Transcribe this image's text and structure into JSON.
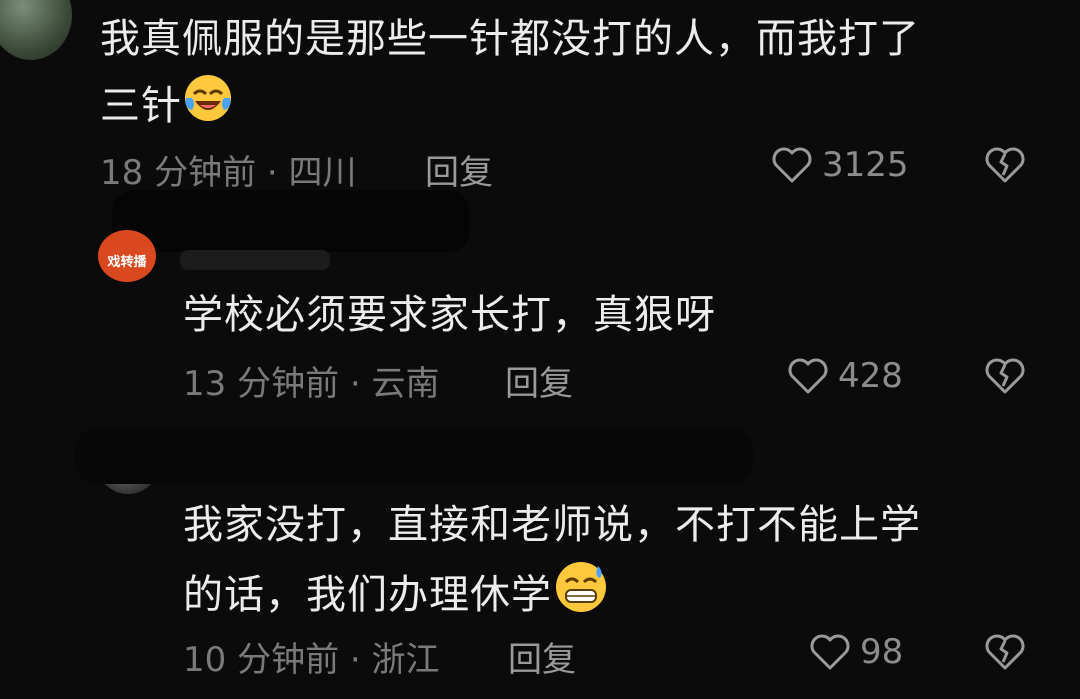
{
  "comments": [
    {
      "text_line1": "我真佩服的是那些一针都没打的人，而我打了",
      "text_line2": "三针",
      "emoji": "laughing-crying-emoji",
      "time": "18 分钟前 · 四川",
      "reply_label": "回复",
      "like_count": "3125"
    },
    {
      "avatar_text": "戏转播",
      "text_line1": "学校必须要求家长打，真狠呀",
      "time": "13 分钟前 · 云南",
      "reply_label": "回复",
      "like_count": "428"
    },
    {
      "text_line1": "我家没打，直接和老师说，不打不能上学",
      "text_line2": "的话，我们办理休学",
      "emoji": "grinning-sweat-emoji",
      "time": "10 分钟前 · 浙江",
      "reply_label": "回复",
      "like_count": "98"
    }
  ],
  "icons": {
    "like": "heart-outline-icon",
    "dislike": "broken-heart-icon"
  },
  "colors": {
    "background": "#0b0b0b",
    "text": "#ececec",
    "meta": "#7a7a7a",
    "avatar_brand": "#d9481f"
  }
}
